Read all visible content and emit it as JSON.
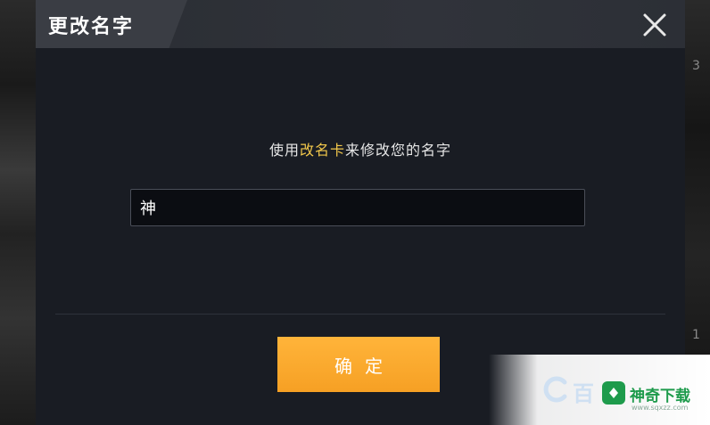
{
  "dialog": {
    "title": "更改名字",
    "prompt_before": "使用",
    "prompt_highlight": "改名卡",
    "prompt_after": "来修改您的名字",
    "name_input_value": "神",
    "confirm_label": "确定",
    "close_icon": "close-icon",
    "highlight_color": "#f2c84b",
    "confirm_color": "#f6a024"
  },
  "background": {
    "right_edge_digits": [
      "3",
      "1"
    ]
  },
  "watermark": {
    "brand_text": "神奇下载",
    "url_text": "www.sqxzz.com"
  }
}
